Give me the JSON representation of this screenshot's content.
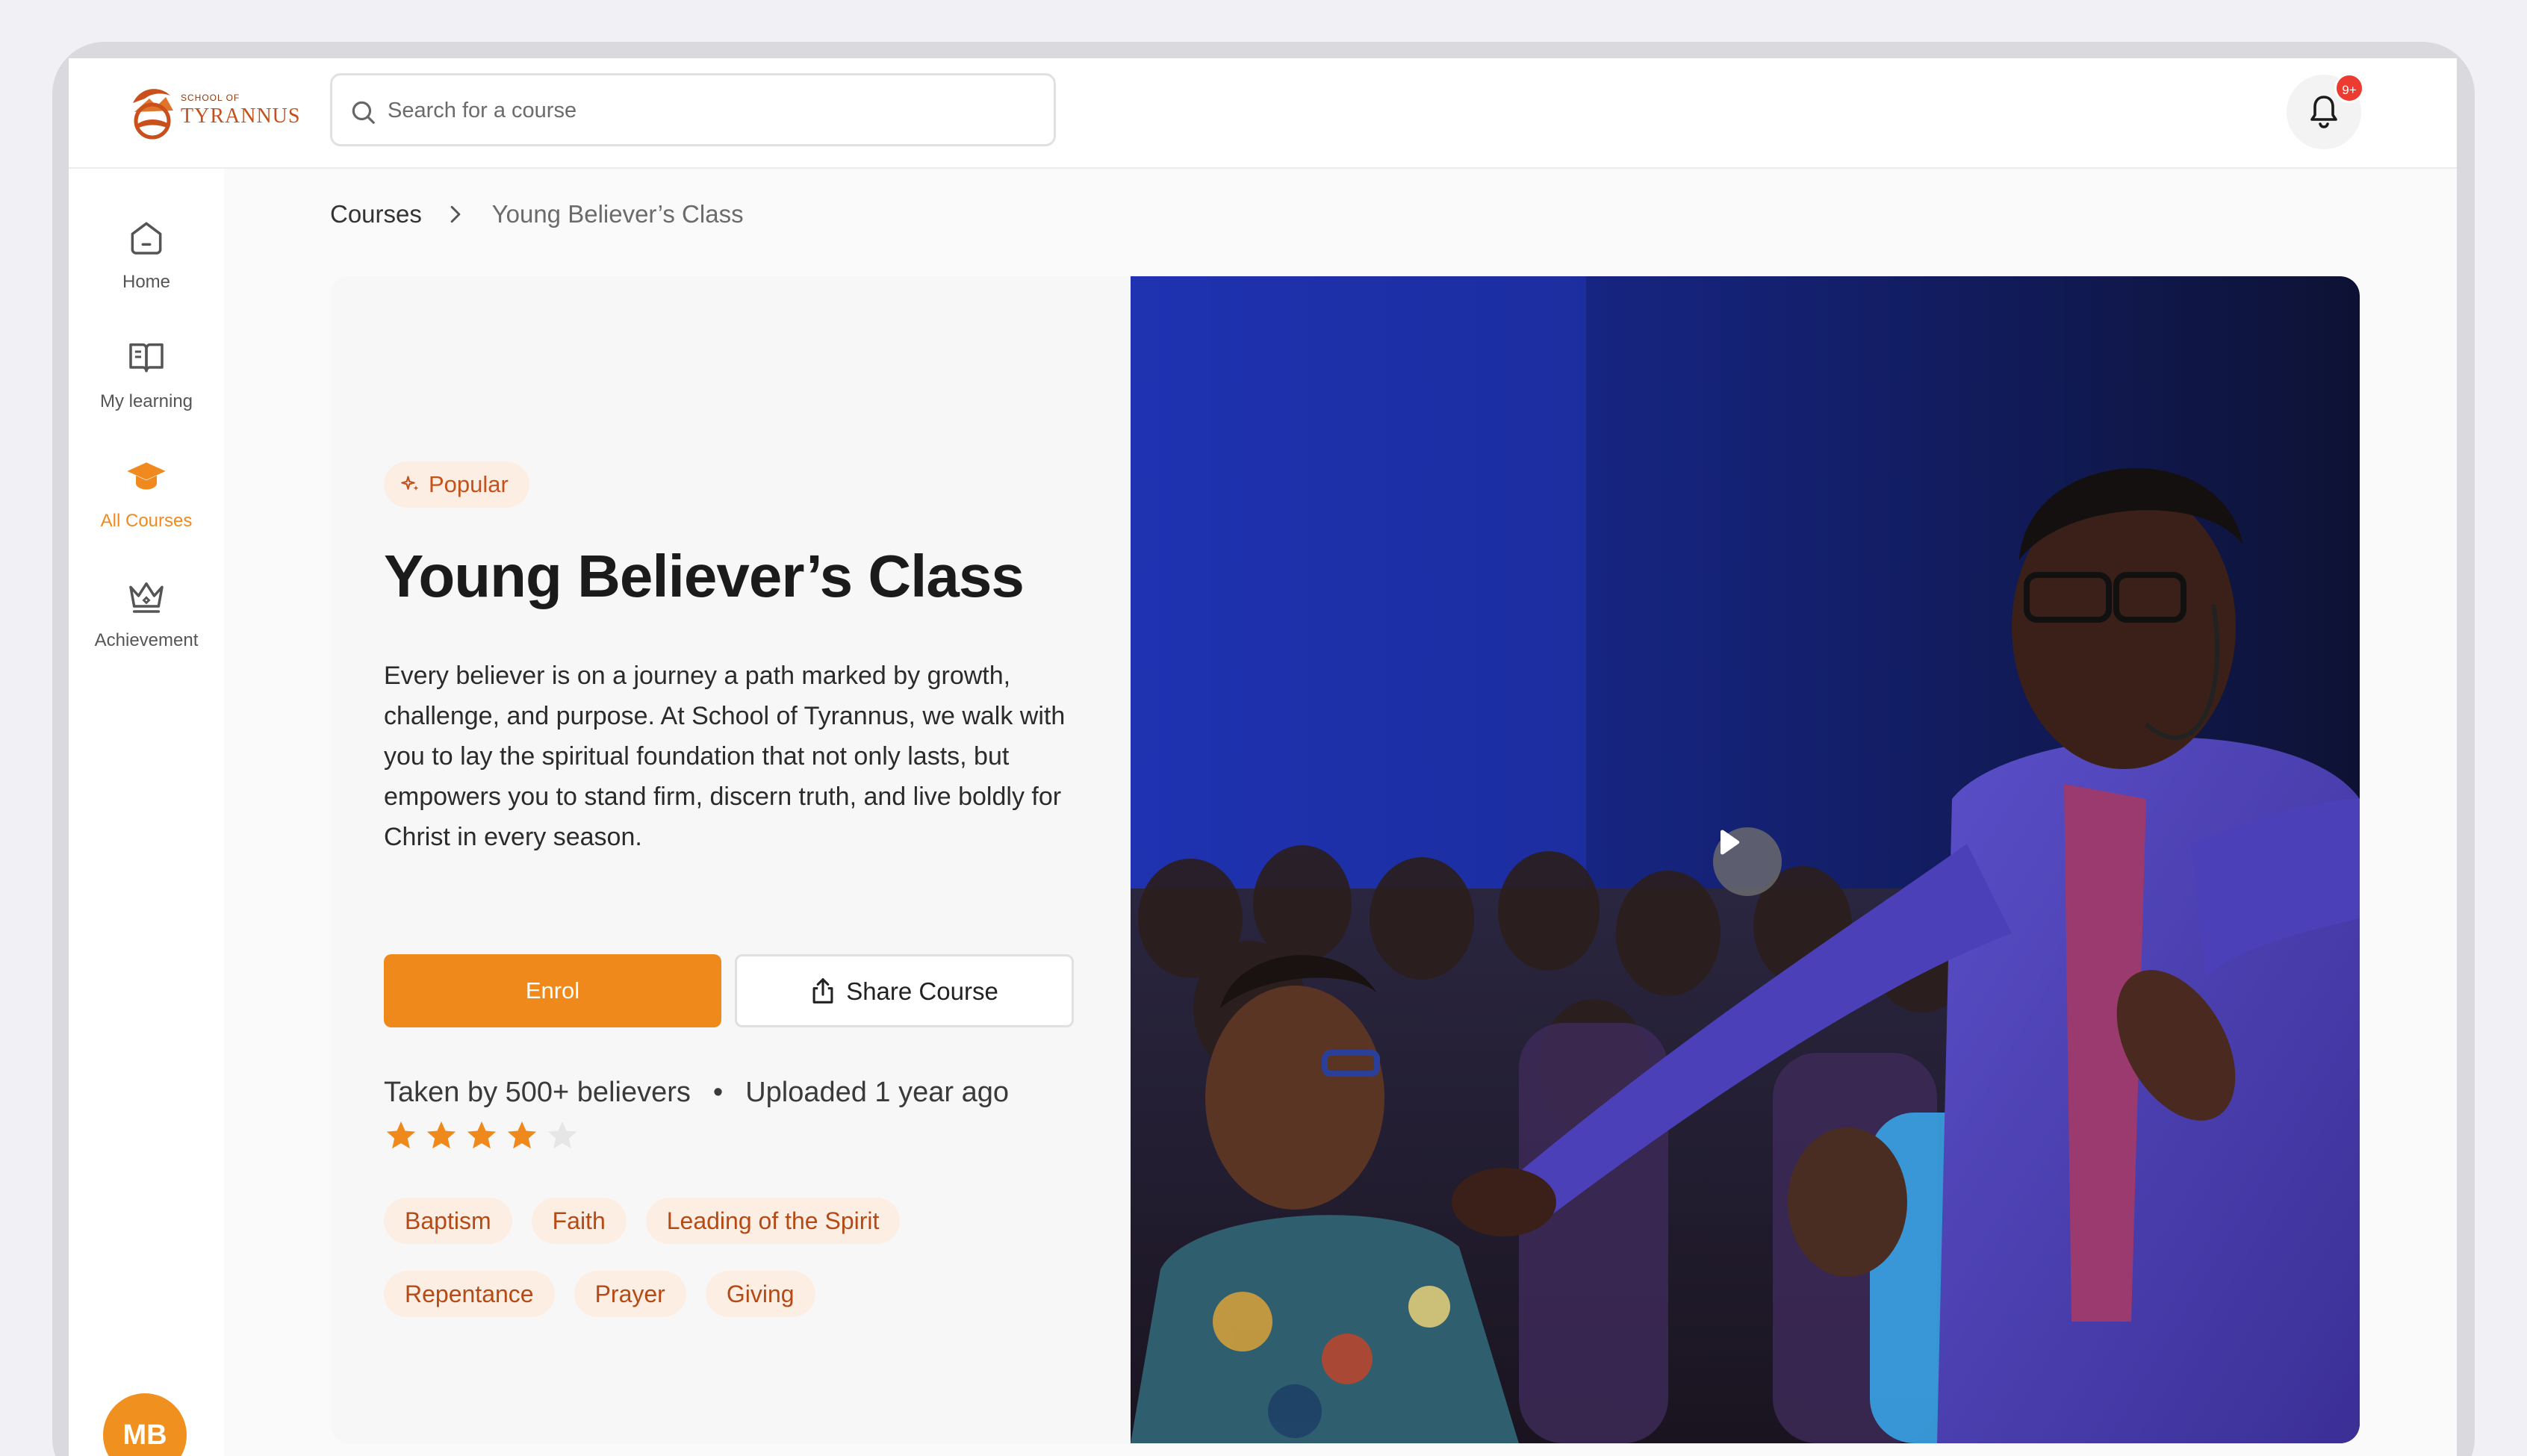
{
  "app": {
    "logo_small": "SCHOOL OF",
    "logo_big": "TYRANNUS"
  },
  "search": {
    "placeholder": "Search for a course",
    "value": ""
  },
  "notifications": {
    "badge": "9+"
  },
  "sidebar": {
    "items": [
      {
        "label": "Home",
        "icon": "home-icon",
        "active": false
      },
      {
        "label": "My learning",
        "icon": "book-icon",
        "active": false
      },
      {
        "label": "All Courses",
        "icon": "graduation-cap-icon",
        "active": true
      },
      {
        "label": "Achievement",
        "icon": "crown-icon",
        "active": false
      }
    ],
    "avatar_initials": "MB"
  },
  "breadcrumb": {
    "root": "Courses",
    "current": "Young Believer’s Class"
  },
  "course": {
    "badge": "Popular",
    "title": "Young Believer’s Class",
    "description": "Every believer is on a journey a path marked by growth, challenge, and purpose. At School of Tyrannus, we walk with you to lay the spiritual foundation that not only lasts, but empowers you to stand firm, discern truth, and live boldly for Christ in every season.",
    "enrol_label": "Enrol",
    "share_label": "Share Course",
    "taken_by": "Taken by 500+ believers",
    "separator": "•",
    "uploaded": "Uploaded 1 year ago",
    "rating": 4,
    "rating_max": 5,
    "tags_row1": [
      "Baptism",
      "Faith",
      "Leading of the Spirit"
    ],
    "tags_row2": [
      "Repentance",
      "Prayer",
      "Giving"
    ]
  },
  "colors": {
    "accent": "#f0891b",
    "tag_bg": "#fdeee4",
    "tag_text": "#b54a14",
    "star_on": "#f0891b",
    "star_off": "#e6e6e6",
    "badge": "#ec3b30"
  }
}
